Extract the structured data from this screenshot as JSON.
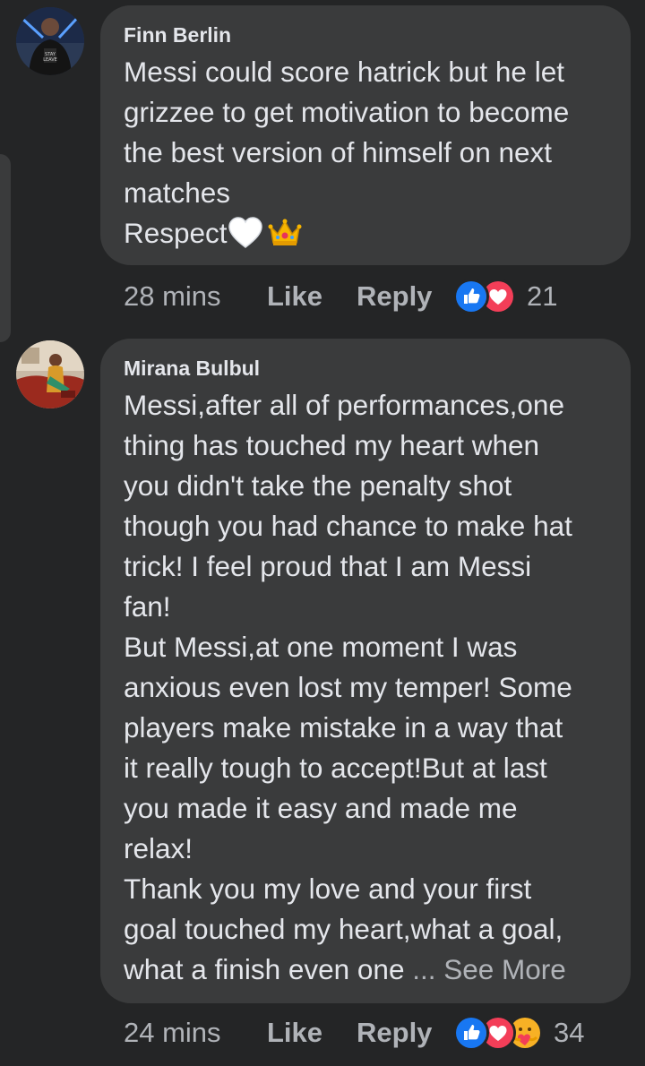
{
  "comments": [
    {
      "author": "Finn Berlin",
      "lines": [
        "Messi could score hatrick but he let",
        "grizzee to get motivation to become",
        "the best version of himself on next",
        "matches"
      ],
      "last_line": "Respect",
      "emojis": [
        "white-heart-icon",
        "crown-icon"
      ],
      "time": "28 mins",
      "like_label": "Like",
      "reply_label": "Reply",
      "reactions": [
        "like-reaction-icon",
        "love-reaction-icon"
      ],
      "reaction_count": "21"
    },
    {
      "author": "Mirana Bulbul",
      "lines": [
        "Messi,after all of performances,one",
        "thing has touched my heart when",
        "you didn't take the penalty shot",
        "though you had chance to make hat",
        "trick! I feel proud that I am Messi",
        "fan!",
        "But Messi,at one moment I was",
        "anxious even lost my temper! Some",
        "players make mistake in a way that",
        "it really tough to accept!But at last",
        "you made it easy and made me",
        "relax!",
        "Thank you my love and your first",
        "goal touched my heart,what a goal,"
      ],
      "last_line": "what a finish even one",
      "ellipsis": " ... ",
      "see_more": "See More",
      "time": "24 mins",
      "like_label": "Like",
      "reply_label": "Reply",
      "reactions": [
        "like-reaction-icon",
        "love-reaction-icon",
        "care-reaction-icon"
      ],
      "reaction_count": "34"
    }
  ],
  "colors": {
    "background": "#242526",
    "bubble": "#3a3b3c",
    "text": "#e4e6eb",
    "secondary_text": "#b0b3b8",
    "like_blue": "#1877f2",
    "love_red": "#f33e58"
  }
}
